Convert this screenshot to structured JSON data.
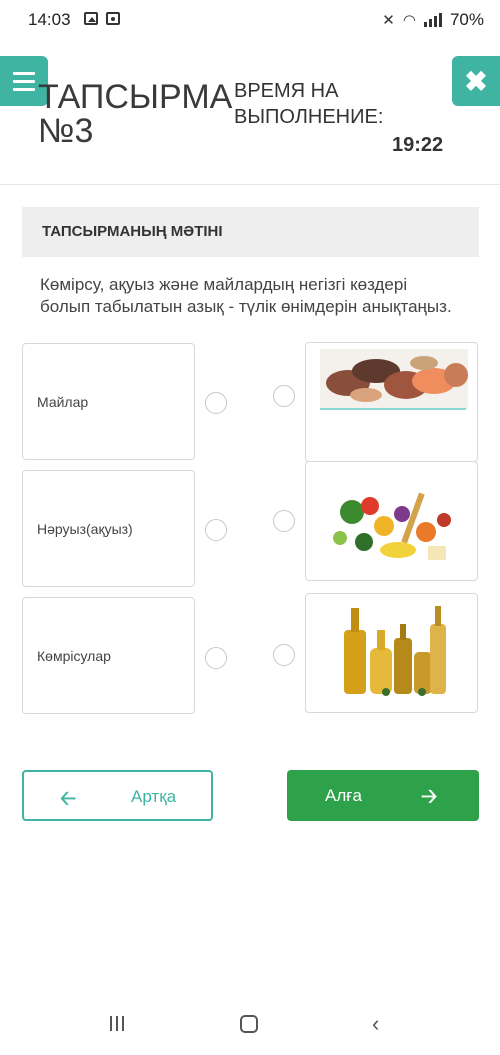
{
  "status_bar": {
    "time": "14:03",
    "battery": "70%"
  },
  "header": {
    "task_title": "ТАПСЫРМА №3",
    "time_label": "ВРЕМЯ НА ВЫПОЛНЕНИЕ:",
    "time_value": "19:22"
  },
  "section": {
    "title": "ТАПСЫРМАНЫҢ МӘТІНІ",
    "question": "Көмірсу, ақуыз және майлардың негізгі көздері болып табылатын азық - түлік өнімдерін анықтаңыз."
  },
  "left_items": [
    {
      "label": "Майлар"
    },
    {
      "label": "Нәруыз(ақуыз)"
    },
    {
      "label": "Көмрісулар"
    }
  ],
  "right_items": [
    {
      "image": "meat-fish-image"
    },
    {
      "image": "vegetables-pasta-image"
    },
    {
      "image": "oil-bottles-image"
    }
  ],
  "nav": {
    "back_label": "Артқа",
    "next_label": "Алға"
  },
  "colors": {
    "accent": "#3fb4a2",
    "next_button": "#2ea24a",
    "section_bg": "#eeeeee"
  }
}
